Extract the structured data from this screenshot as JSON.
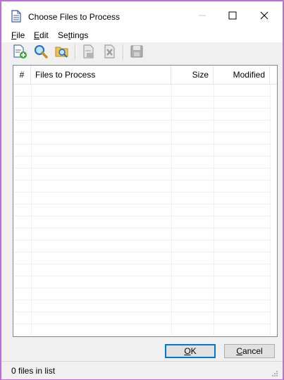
{
  "window": {
    "title": "Choose Files to Process"
  },
  "menu": {
    "file": {
      "mnemonic": "F",
      "rest": "ile"
    },
    "edit": {
      "mnemonic": "E",
      "rest": "dit"
    },
    "settings": {
      "pre": "Se",
      "mnemonic": "t",
      "rest": "tings"
    }
  },
  "toolbar": {
    "items": [
      {
        "icon": "add-file-icon",
        "enabled": true
      },
      {
        "icon": "search-icon",
        "enabled": true
      },
      {
        "icon": "browse-folder-icon",
        "enabled": true
      },
      {
        "icon": "remove-file-icon",
        "enabled": false
      },
      {
        "icon": "clear-list-icon",
        "enabled": false
      },
      {
        "icon": "save-icon",
        "enabled": false
      }
    ]
  },
  "list": {
    "columns": {
      "num": "#",
      "name": "Files to Process",
      "size": "Size",
      "modified": "Modified"
    },
    "rows": []
  },
  "buttons": {
    "ok": {
      "mnemonic": "O",
      "rest": "K"
    },
    "cancel": {
      "mnemonic": "C",
      "rest": "ancel"
    }
  },
  "status": {
    "text": "0 files in list"
  },
  "colors": {
    "window_border": "#c36bdc",
    "accent": "#0078d7"
  }
}
